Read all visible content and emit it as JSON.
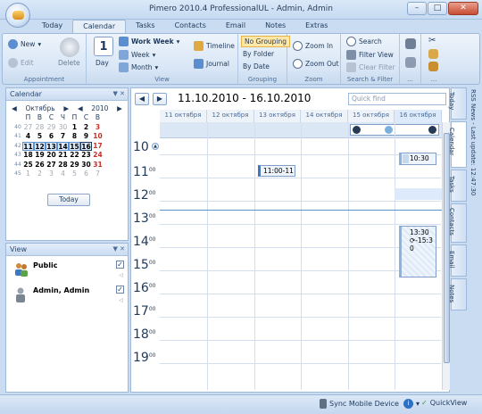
{
  "window": {
    "title": "Pimero 2010.4 ProfessionalUL - Admin, Admin",
    "min": "–",
    "max": "□",
    "close": "✕"
  },
  "menu_tabs": [
    "Today",
    "Calendar",
    "Tasks",
    "Contacts",
    "Email",
    "Notes",
    "Extras"
  ],
  "ribbon": {
    "appointment": {
      "new": "New",
      "edit": "Edit",
      "delete": "Delete",
      "label": "Appointment"
    },
    "view": {
      "day": "Day",
      "day_num": "1",
      "work_week": "Work Week",
      "week": "Week",
      "month": "Month",
      "timeline": "Timeline",
      "journal": "Journal",
      "label": "View"
    },
    "grouping": {
      "no_grouping": "No Grouping",
      "by_folder": "By Folder",
      "by_date": "By Date",
      "label": "Grouping"
    },
    "zoom": {
      "zoom_in": "Zoom In",
      "zoom_out": "Zoom Out",
      "label": "Zoom"
    },
    "search": {
      "search": "Search",
      "filter_view": "Filter View",
      "clear_filter": "Clear Filter",
      "label": "Search & Filter"
    },
    "more1": "...",
    "more2": "..."
  },
  "calendar_panel": {
    "title": "Calendar",
    "pin": "▼ ✕",
    "month": "Октябрь",
    "year": "2010",
    "weekdays": [
      "П",
      "В",
      "С",
      "Ч",
      "П",
      "С",
      "В"
    ],
    "weeks": [
      {
        "wk": "40",
        "days": [
          "27",
          "28",
          "29",
          "30",
          "1",
          "2",
          "3"
        ]
      },
      {
        "wk": "41",
        "days": [
          "4",
          "5",
          "6",
          "7",
          "8",
          "9",
          "10"
        ]
      },
      {
        "wk": "42",
        "days": [
          "11",
          "12",
          "13",
          "14",
          "15",
          "16",
          "17"
        ]
      },
      {
        "wk": "43",
        "days": [
          "18",
          "19",
          "20",
          "21",
          "22",
          "23",
          "24"
        ]
      },
      {
        "wk": "44",
        "days": [
          "25",
          "26",
          "27",
          "28",
          "29",
          "30",
          "31"
        ]
      },
      {
        "wk": "45",
        "days": [
          "1",
          "2",
          "3",
          "4",
          "5",
          "6",
          "7"
        ]
      }
    ],
    "today_button": "Today"
  },
  "view_panel": {
    "title": "View",
    "pin": "▼ ✕",
    "users": [
      {
        "name": "Public",
        "checked": true
      },
      {
        "name": "Admin, Admin",
        "checked": true
      }
    ]
  },
  "main": {
    "prev": "◀",
    "next": "▶",
    "range": "11.10.2010 - 16.10.2010",
    "quick_find_placeholder": "Quick find",
    "days": [
      "11 октября",
      "12 октября",
      "13 октября",
      "14 октября",
      "15 октября",
      "16 октября"
    ],
    "hours": [
      "10",
      "11",
      "12",
      "13",
      "14",
      "15",
      "16",
      "17",
      "18",
      "19"
    ],
    "minutes": "00",
    "appointments": [
      {
        "text": "11:00-11"
      },
      {
        "text": "10:30"
      },
      {
        "text": "13:30"
      },
      {
        "text": "-15:3"
      },
      {
        "text": "0"
      }
    ]
  },
  "right_tabs": [
    "Today",
    "Calendar",
    "Tasks",
    "Contacts",
    "Email",
    "Notes"
  ],
  "rss": "RSS News - Last update: 12:47:30",
  "statusbar": {
    "sync": "Sync Mobile Device",
    "info": "i",
    "quickview": "QuickView"
  },
  "colors": {
    "accent": "#1e395b",
    "ribbon": "#d8e6f6",
    "selected": "#ffe7a8",
    "weekend": "#c8302a"
  }
}
